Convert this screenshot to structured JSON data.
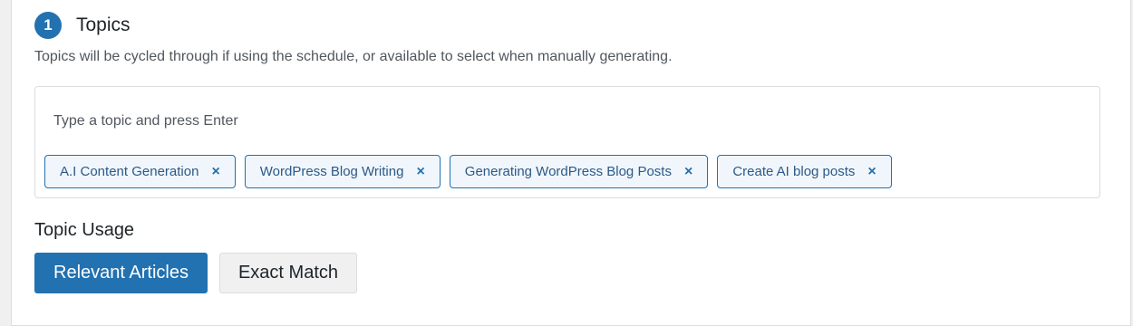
{
  "step": {
    "number": "1",
    "title": "Topics",
    "description": "Topics will be cycled through if using the schedule, or available to select when manually generating."
  },
  "topic_input": {
    "placeholder": "Type a topic and press Enter",
    "value": ""
  },
  "topics": [
    {
      "label": "A.I Content Generation",
      "remove_icon": "×"
    },
    {
      "label": "WordPress Blog Writing",
      "remove_icon": "×"
    },
    {
      "label": "Generating WordPress Blog Posts",
      "remove_icon": "×"
    },
    {
      "label": "Create AI blog posts",
      "remove_icon": "×"
    }
  ],
  "topic_usage": {
    "heading": "Topic Usage",
    "options": [
      {
        "label": "Relevant Articles",
        "selected": true
      },
      {
        "label": "Exact Match",
        "selected": false
      }
    ]
  },
  "colors": {
    "accent": "#2271b1",
    "tag_background": "#f0f6fc",
    "secondary_button": "#f0f0f1",
    "border": "#dcdcde"
  },
  "icons": {
    "tag_remove": "close-icon"
  }
}
